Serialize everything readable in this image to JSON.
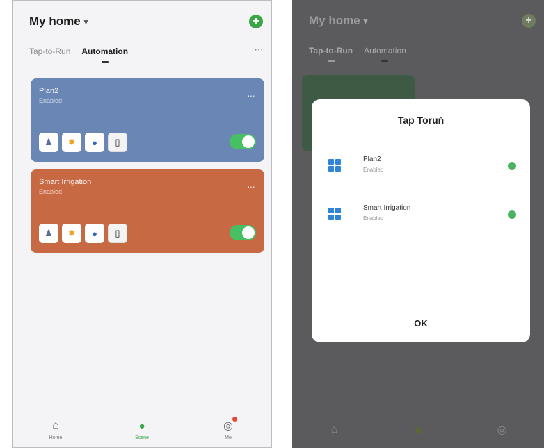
{
  "left": {
    "home_title": "My home",
    "tabs": [
      {
        "label": "Tap-to-Run",
        "active": false
      },
      {
        "label": "Automation",
        "active": true
      }
    ],
    "cards": [
      {
        "name": "Plan2",
        "sub": "Enabled",
        "color": "#6a86b5",
        "enabled": true
      },
      {
        "name": "Smart Irrigation",
        "sub": "Enabled",
        "color": "#c76a44",
        "enabled": true
      }
    ],
    "nav": [
      {
        "label": "Home",
        "icon": "home-icon"
      },
      {
        "label": "Scene",
        "icon": "scene-icon",
        "active": true
      },
      {
        "label": "Me",
        "icon": "profile-icon"
      }
    ]
  },
  "right": {
    "home_title": "My home",
    "tabs": [
      {
        "label": "Tap-to-Run"
      },
      {
        "label": "Automation"
      }
    ],
    "modal": {
      "title": "Tap Toruń",
      "items": [
        {
          "name": "Plan2",
          "status": "Enabled"
        },
        {
          "name": "Smart Irrigation",
          "status": "Enabled"
        }
      ],
      "ok_label": "OK"
    }
  },
  "colors": {
    "accent_green": "#3aa648",
    "toggle_green": "#46c063",
    "card_blue": "#6a86b5",
    "card_orange": "#c76a44",
    "grid_icon_blue": "#2f86d9"
  }
}
